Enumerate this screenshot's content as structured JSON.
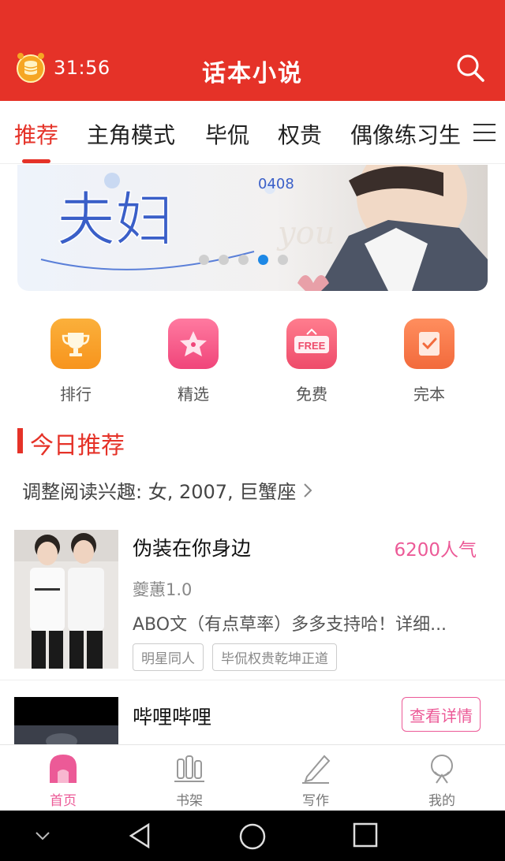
{
  "header": {
    "timer": "31:56",
    "title": "话本小说",
    "timer_icon": "coin-alarm-icon",
    "search_icon": "search-icon",
    "bg_color": "#e53228"
  },
  "tabs": [
    {
      "label": "推荐",
      "active": true
    },
    {
      "label": "主角模式",
      "active": false
    },
    {
      "label": "毕侃",
      "active": false
    },
    {
      "label": "权贵",
      "active": false
    },
    {
      "label": "偶像练习生",
      "active": false
    }
  ],
  "banner": {
    "art_text": "夫妇",
    "sub_text": "0408",
    "script_text": "you",
    "slides": 5,
    "active_slide": 4
  },
  "categories": [
    {
      "label": "排行",
      "icon": "trophy-icon",
      "color": "#f7941d"
    },
    {
      "label": "精选",
      "icon": "star-icon",
      "color": "#f0457a"
    },
    {
      "label": "免费",
      "icon": "free-sign-icon",
      "color": "#ee4b6a",
      "icon_text": "FREE"
    },
    {
      "label": "完本",
      "icon": "checklist-icon",
      "color": "#f26a3c"
    }
  ],
  "section": {
    "title": "今日推荐",
    "interest": "调整阅读兴趣: 女, 2007, 巨蟹座"
  },
  "books": [
    {
      "title": "伪装在你身边",
      "popularity": "6200人气",
      "author": "夔蕙1.0",
      "description": "ABO文（有点草率）多多支持哈！详细...",
      "tags": [
        "明星同人",
        "毕侃权贵乾坤正道"
      ]
    },
    {
      "title": "哔哩哔哩",
      "button": "查看详情"
    }
  ],
  "bottom_nav": [
    {
      "label": "首页",
      "icon": "home-icon",
      "active": true
    },
    {
      "label": "书架",
      "icon": "bookshelf-icon",
      "active": false
    },
    {
      "label": "写作",
      "icon": "pen-icon",
      "active": false
    },
    {
      "label": "我的",
      "icon": "profile-icon",
      "active": false
    }
  ],
  "colors": {
    "accent": "#e53228",
    "pink": "#ec5a97",
    "dot_active": "#1e88e5"
  }
}
